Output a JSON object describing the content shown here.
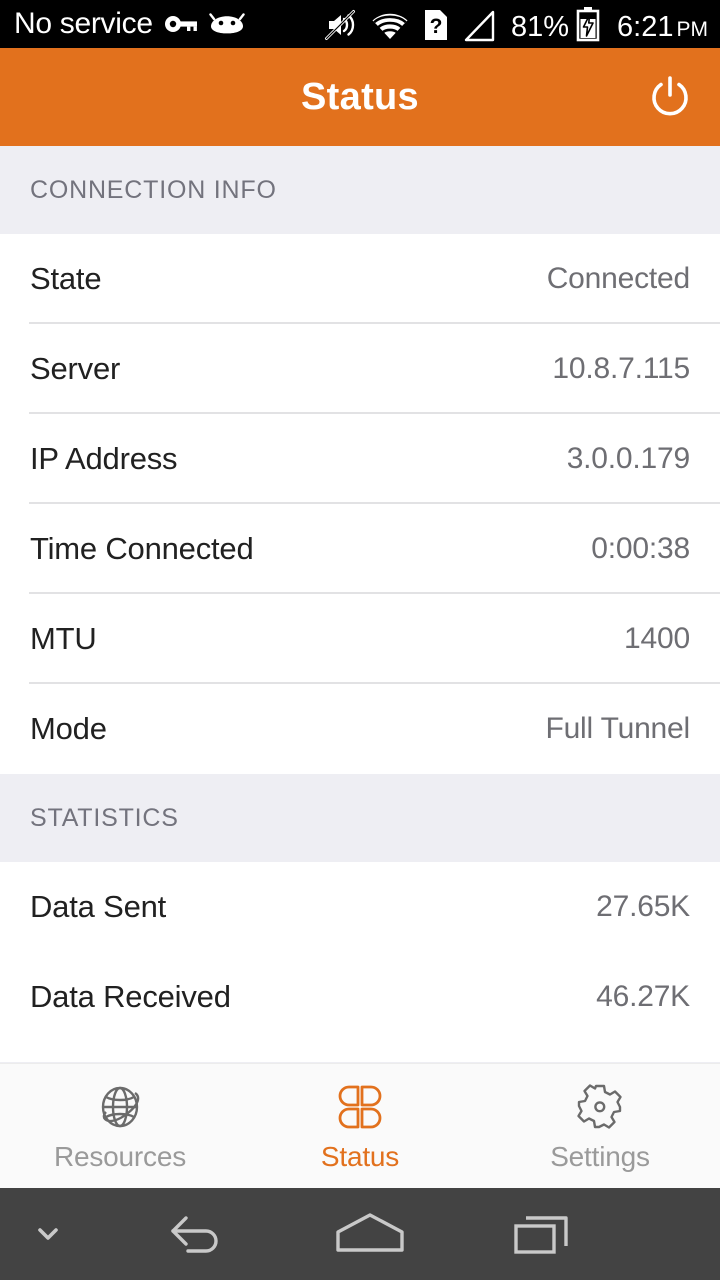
{
  "statusbar": {
    "carrier": "No service",
    "icons_left": [
      "vpn-key-icon",
      "android-head-icon"
    ],
    "icons_right": [
      "volume-muted-icon",
      "wifi-icon",
      "sim-missing-icon",
      "signal-empty-icon"
    ],
    "battery_percent": "81%",
    "battery_state": "charging",
    "clock_time": "6:21",
    "clock_ampm": "PM"
  },
  "appbar": {
    "title": "Status",
    "action_icon": "power-icon",
    "background_color": "#e2711d"
  },
  "sections": [
    {
      "header": "CONNECTION INFO",
      "rows": [
        {
          "label": "State",
          "value": "Connected"
        },
        {
          "label": "Server",
          "value": "10.8.7.115"
        },
        {
          "label": "IP Address",
          "value": "3.0.0.179"
        },
        {
          "label": "Time Connected",
          "value": "0:00:38"
        },
        {
          "label": "MTU",
          "value": "1400"
        },
        {
          "label": "Mode",
          "value": "Full Tunnel"
        }
      ]
    },
    {
      "header": "STATISTICS",
      "rows": [
        {
          "label": "Data Sent",
          "value": "27.65K"
        },
        {
          "label": "Data Received",
          "value": "46.27K"
        }
      ]
    }
  ],
  "tabbar": {
    "active_color": "#e2711d",
    "inactive_color": "#9a9a9a",
    "tabs": [
      {
        "label": "Resources",
        "icon": "globe-icon",
        "active": false
      },
      {
        "label": "Status",
        "icon": "clover-grid-icon",
        "active": true
      },
      {
        "label": "Settings",
        "icon": "gear-icon",
        "active": false
      }
    ]
  },
  "navbar": {
    "collapse_icon": "chevron-down-icon",
    "buttons": [
      {
        "icon": "back-icon"
      },
      {
        "icon": "home-icon"
      },
      {
        "icon": "recents-icon"
      }
    ]
  }
}
